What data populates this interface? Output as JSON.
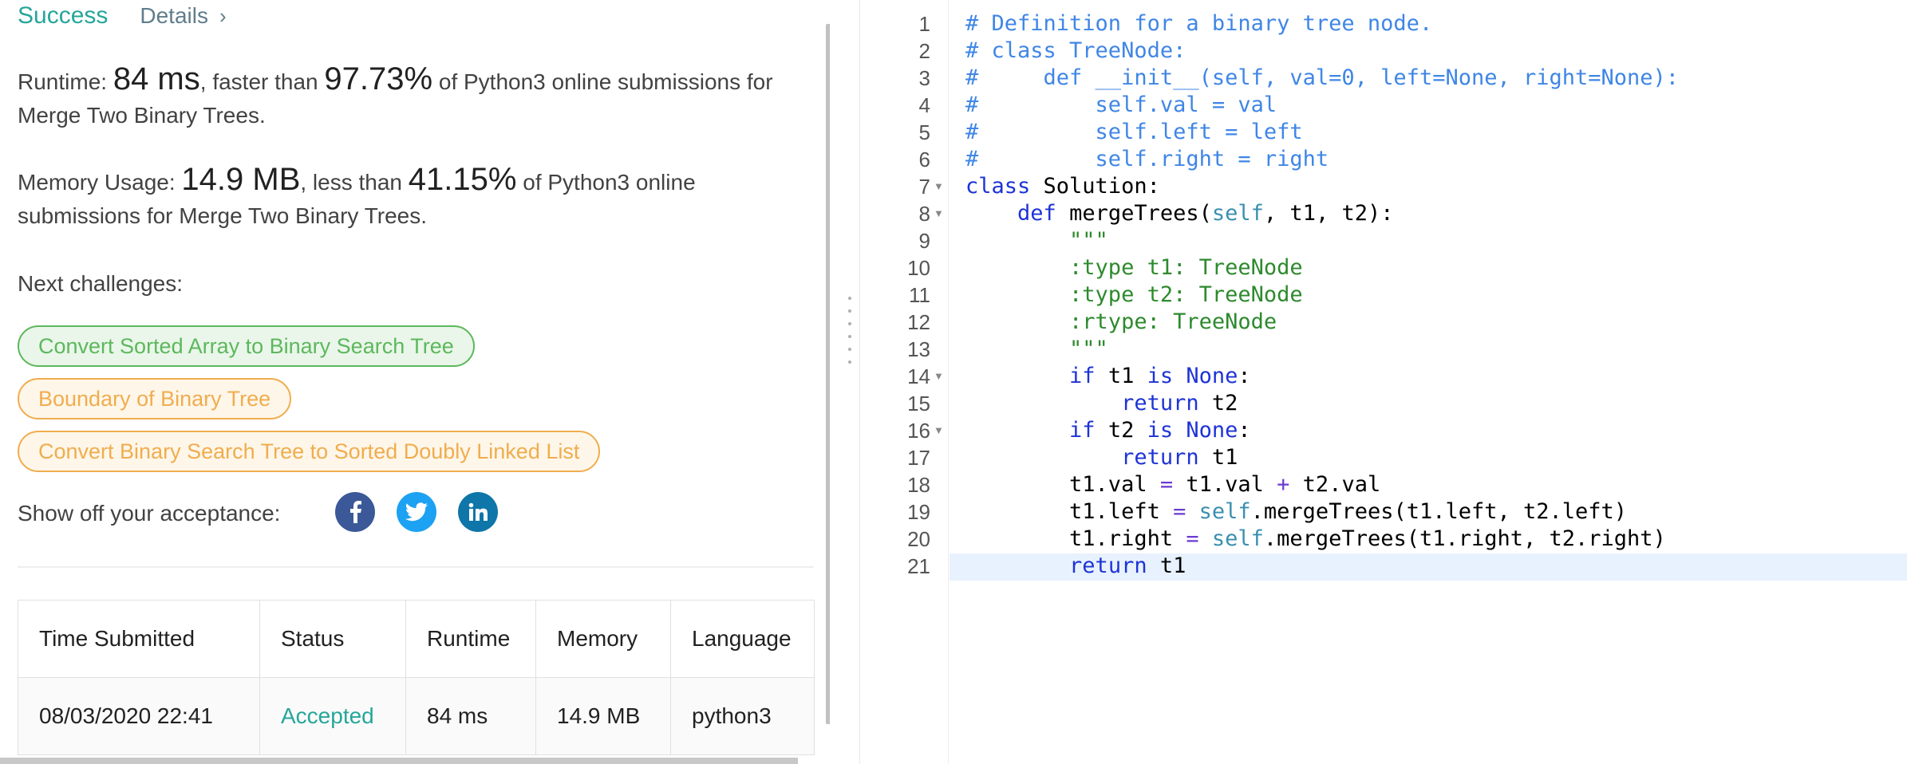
{
  "result": {
    "status": "Success",
    "details_label": "Details",
    "runtime_label": "Runtime:",
    "runtime_value": "84 ms",
    "runtime_mid": ", faster than",
    "runtime_pct": "97.73%",
    "runtime_suffix": "of Python3 online submissions for Merge Two Binary Trees.",
    "memory_label": "Memory Usage:",
    "memory_value": "14.9 MB",
    "memory_mid": ", less than",
    "memory_pct": "41.15%",
    "memory_suffix": "of Python3 online submissions for Merge Two Binary Trees."
  },
  "next_challenges": {
    "label": "Next challenges:",
    "items": [
      {
        "label": "Convert Sorted Array to Binary Search Tree",
        "difficulty": "easy"
      },
      {
        "label": "Boundary of Binary Tree",
        "difficulty": "medium"
      },
      {
        "label": "Convert Binary Search Tree to Sorted Doubly Linked List",
        "difficulty": "medium"
      }
    ]
  },
  "share": {
    "label": "Show off your acceptance:",
    "icons": [
      "facebook-icon",
      "twitter-icon",
      "linkedin-icon"
    ],
    "colors": {
      "facebook": "#3b5998",
      "twitter": "#1da1f2",
      "linkedin": "#0e76a8"
    }
  },
  "submissions": {
    "headers": [
      "Time Submitted",
      "Status",
      "Runtime",
      "Memory",
      "Language"
    ],
    "rows": [
      [
        "08/03/2020 22:41",
        "Accepted",
        "84 ms",
        "14.9 MB",
        "python3"
      ]
    ]
  },
  "editor": {
    "line_numbers": [
      "1",
      "2",
      "3",
      "4",
      "5",
      "6",
      "7",
      "8",
      "9",
      "10",
      "11",
      "12",
      "13",
      "14",
      "15",
      "16",
      "17",
      "18",
      "19",
      "20",
      "21"
    ],
    "fold_lines": [
      7,
      8,
      14,
      16
    ],
    "lines": [
      "# Definition for a binary tree node.",
      "# class TreeNode:",
      "#     def __init__(self, val=0, left=None, right=None):",
      "#         self.val = val",
      "#         self.left = left",
      "#         self.right = right",
      "class Solution:",
      "    def mergeTrees(self, t1, t2):",
      "        \"\"\"",
      "        :type t1: TreeNode",
      "        :type t2: TreeNode",
      "        :rtype: TreeNode",
      "        \"\"\"",
      "        if t1 is None:",
      "            return t2",
      "        if t2 is None:",
      "            return t1",
      "        t1.val = t1.val + t2.val",
      "        t1.left = self.mergeTrees(t1.left, t2.left)",
      "        t1.right = self.mergeTrees(t1.right, t2.right)",
      "        return t1"
    ]
  },
  "colors": {
    "success": "#26a69a",
    "easy": "#5cb85c",
    "medium": "#f0ad4e",
    "comment": "#3f86e6",
    "keyword": "#1e33d6",
    "docstring": "#2d8a2d"
  }
}
